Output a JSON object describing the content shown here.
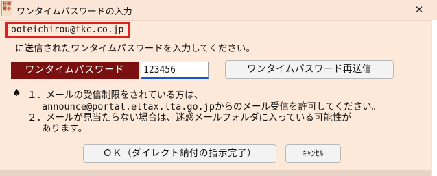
{
  "window": {
    "title": "ワンタイムパスワードの入力",
    "app_icon_text": "税務\n電子",
    "close_glyph": "✕"
  },
  "email": "ooteichirou@tkc.co.jp",
  "instruction": "に送信されたワンタイムパスワードを入力してください。",
  "otp": {
    "label": "ワンタイムパスワード",
    "value": "123456"
  },
  "buttons": {
    "resend": "ワンタイムパスワード再送信",
    "ok": "ＯＫ（ダイレクト納付の指示完了）",
    "cancel": "ｷｬﾝｾﾙ"
  },
  "notes": {
    "bullet": "♠",
    "line1": "１．メールの受信制限をされている方は、",
    "line2": "announce@portal.eltax.lta.go.jpからのメール受信を許可してください。",
    "line3": "２．メールが見当たらない場合は、迷惑メールフォルダに入っている可能性が",
    "line4": "あります。"
  },
  "colors": {
    "background": "#fde9d9",
    "label_bg": "#7b1010",
    "highlight_border": "#e02020"
  }
}
